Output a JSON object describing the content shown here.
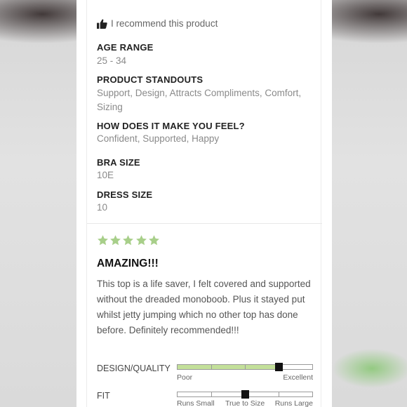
{
  "recommend": {
    "text": "I recommend this product",
    "icon": "thumbs-up-icon"
  },
  "attributes": [
    {
      "title": "AGE RANGE",
      "value": "25 - 34"
    },
    {
      "title": "PRODUCT STANDOUTS",
      "value": "Support, Design, Attracts Compliments, Comfort, Sizing"
    },
    {
      "title": "HOW DOES IT MAKE YOU FEEL?",
      "value": "Confident, Supported, Happy"
    },
    {
      "title": "BRA SIZE",
      "value": "10E"
    },
    {
      "title": "DRESS SIZE",
      "value": "10"
    }
  ],
  "review": {
    "rating": 5,
    "max_rating": 5,
    "star_color": "#a8cf8a",
    "title": "AMAZING!!!",
    "body": "This top is a life saver, I felt covered and supported without the dreaded monoboob. Plus it stayed put whilst jetty jumping which no other top has done before. Definitely recommended!!!"
  },
  "ratings": [
    {
      "label": "DESIGN/QUALITY",
      "value": 0.75,
      "fill": true,
      "left_caption": "Poor",
      "mid_caption": "",
      "right_caption": "Excellent"
    },
    {
      "label": "FIT",
      "value": 0.5,
      "fill": false,
      "left_caption": "Runs Small",
      "mid_caption": "True to Size",
      "right_caption": "Runs Large"
    }
  ],
  "colors": {
    "accent_green": "#c3e09a",
    "star_green": "#a8cf8a"
  }
}
